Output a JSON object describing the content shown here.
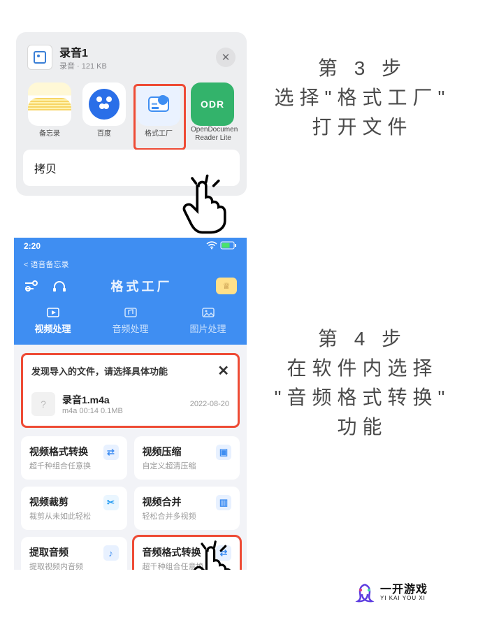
{
  "step3": {
    "header_title": "录音1",
    "header_sub": "录音 · 121 KB",
    "apps": [
      {
        "label": "备忘录"
      },
      {
        "label": "百度"
      },
      {
        "label": "格式工厂"
      },
      {
        "label": "OpenDocumen Reader Lite"
      }
    ],
    "action_copy": "拷贝",
    "caption_line1": "第 3 步",
    "caption_line2": "选择\"格式工厂\"",
    "caption_line3": "打开文件"
  },
  "step4": {
    "time": "2:20",
    "back": "< 语音备忘录",
    "title": "格式工厂",
    "tabs": [
      {
        "label": "视频处理",
        "active": true
      },
      {
        "label": "音频处理",
        "active": false
      },
      {
        "label": "图片处理",
        "active": false
      }
    ],
    "import_header": "发现导入的文件，请选择具体功能",
    "import_file": {
      "name": "录音1.m4a",
      "meta": "m4a  00:14  0.1MB",
      "date": "2022-08-20"
    },
    "functions": [
      {
        "title": "视频格式转换",
        "sub": "超千种组合任意换"
      },
      {
        "title": "视频压缩",
        "sub": "自定义超清压缩"
      },
      {
        "title": "视频裁剪",
        "sub": "裁剪从未如此轻松"
      },
      {
        "title": "视频合并",
        "sub": "轻松合并多视频"
      },
      {
        "title": "提取音频",
        "sub": "提取视频内音频"
      },
      {
        "title": "音频格式转换",
        "sub": "超千种组合任意换"
      }
    ],
    "caption_line1": "第 4 步",
    "caption_line2": "在软件内选择",
    "caption_line3": "\"音频格式转换\"",
    "caption_line4": "功能"
  },
  "watermark": {
    "t1": "一开游戏",
    "t2": "YI KAI YOU XI"
  }
}
